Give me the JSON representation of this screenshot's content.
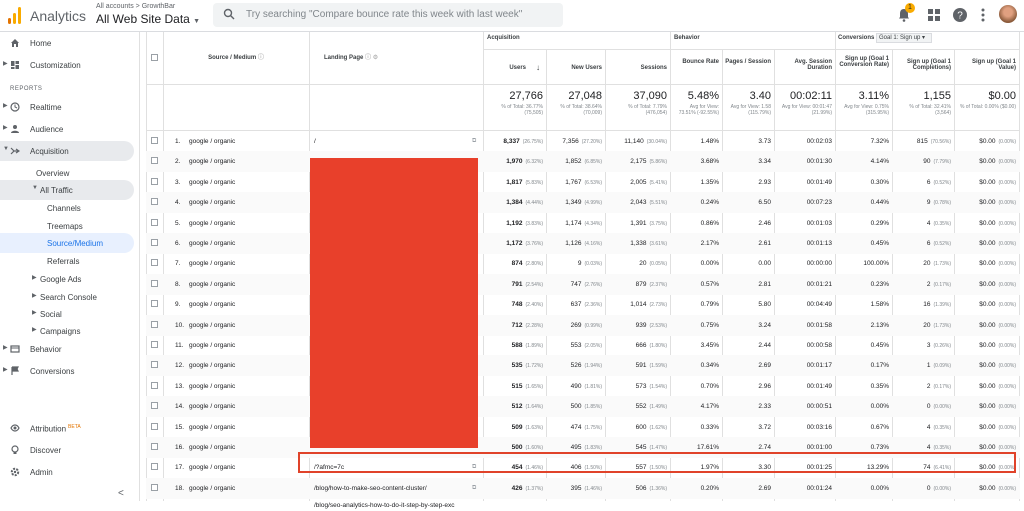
{
  "header": {
    "brand": "Analytics",
    "breadcrumb": "All accounts > GrowthBar",
    "view": "All Web Site Data",
    "search_placeholder": "Try searching \"Compare bounce rate this week with last week\"",
    "notification_count": "1"
  },
  "sidebar": {
    "items": [
      {
        "label": "Home",
        "icon": "home-icon"
      },
      {
        "label": "Customization",
        "icon": "dashboard-icon"
      }
    ],
    "reports_label": "REPORTS",
    "reports": [
      {
        "label": "Realtime",
        "icon": "clock-icon"
      },
      {
        "label": "Audience",
        "icon": "person-icon"
      },
      {
        "label": "Acquisition",
        "icon": "acquisition-icon"
      }
    ],
    "acquisition_children": [
      "Overview",
      "All Traffic",
      "Channels",
      "Treemaps",
      "Source/Medium",
      "Referrals",
      "Google Ads",
      "Search Console",
      "Social",
      "Campaigns"
    ],
    "bottom_reports": [
      {
        "label": "Behavior",
        "icon": "behavior-icon"
      },
      {
        "label": "Conversions",
        "icon": "flag-icon"
      }
    ],
    "footer": [
      {
        "label": "Attribution",
        "badge": "BETA",
        "icon": "attribution-icon"
      },
      {
        "label": "Discover",
        "icon": "bulb-icon"
      },
      {
        "label": "Admin",
        "icon": "gear-icon"
      }
    ],
    "collapse": "<"
  },
  "table": {
    "col_headers": {
      "source": "Source / Medium",
      "landing": "Landing Page",
      "acquisition": "Acquisition",
      "behavior": "Behavior",
      "conversions": "Conversions",
      "goal_select": "Goal 1: Sign up",
      "users": "Users",
      "new_users": "New Users",
      "sessions": "Sessions",
      "bounce_rate": "Bounce Rate",
      "pages_session": "Pages / Session",
      "avg_duration": "Avg. Session Duration",
      "conv_rate": "Sign up (Goal 1 Conversion Rate)",
      "completions": "Sign up (Goal 1 Completions)",
      "value": "Sign up (Goal 1 Value)"
    },
    "totals": {
      "users": "27,766",
      "users_sub": "% of Total: 36.77% (75,505)",
      "new_users": "27,048",
      "new_users_sub": "% of Total: 38.64% (70,009)",
      "sessions": "37,090",
      "sessions_sub": "% of Total: 7.79% (476,054)",
      "bounce": "5.48%",
      "bounce_sub": "Avg for View: 73.51% (-92.55%)",
      "pages": "3.40",
      "pages_sub": "Avg for View: 1.58 (115.79%)",
      "duration": "00:02:11",
      "duration_sub": "Avg for View: 00:01:47 (21.99%)",
      "conv": "3.11%",
      "conv_sub": "Avg for View: 0.75% (315.95%)",
      "completions": "1,155",
      "completions_sub": "% of Total: 32.41% (3,564)",
      "value": "$0.00",
      "value_sub": "% of Total: 0.00% ($0.00)"
    },
    "rows": [
      {
        "n": "1.",
        "src": "google / organic",
        "page": "/",
        "u": "8,337",
        "up": "(26.75%)",
        "nu": "7,356",
        "nup": "(27.20%)",
        "s": "11,140",
        "sp": "(30.04%)",
        "br": "1.48%",
        "ps": "3.73",
        "d": "00:02:03",
        "cr": "7.32%",
        "cm": "815",
        "cmp": "(70.56%)",
        "v": "$0.00",
        "vp": "(0.00%)"
      },
      {
        "n": "2.",
        "src": "google / organic",
        "page": "",
        "u": "1,970",
        "up": "(6.32%)",
        "nu": "1,852",
        "nup": "(6.85%)",
        "s": "2,175",
        "sp": "(5.86%)",
        "br": "3.68%",
        "ps": "3.34",
        "d": "00:01:30",
        "cr": "4.14%",
        "cm": "90",
        "cmp": "(7.79%)",
        "v": "$0.00",
        "vp": "(0.00%)"
      },
      {
        "n": "3.",
        "src": "google / organic",
        "page": "",
        "u": "1,817",
        "up": "(5.83%)",
        "nu": "1,767",
        "nup": "(6.53%)",
        "s": "2,005",
        "sp": "(5.41%)",
        "br": "1.35%",
        "ps": "2.93",
        "d": "00:01:49",
        "cr": "0.30%",
        "cm": "6",
        "cmp": "(0.52%)",
        "v": "$0.00",
        "vp": "(0.00%)"
      },
      {
        "n": "4.",
        "src": "google / organic",
        "page": "",
        "u": "1,384",
        "up": "(4.44%)",
        "nu": "1,349",
        "nup": "(4.99%)",
        "s": "2,043",
        "sp": "(5.51%)",
        "br": "0.24%",
        "ps": "6.50",
        "d": "00:07:23",
        "cr": "0.44%",
        "cm": "9",
        "cmp": "(0.78%)",
        "v": "$0.00",
        "vp": "(0.00%)"
      },
      {
        "n": "5.",
        "src": "google / organic",
        "page": "",
        "u": "1,192",
        "up": "(3.83%)",
        "nu": "1,174",
        "nup": "(4.34%)",
        "s": "1,391",
        "sp": "(3.75%)",
        "br": "0.86%",
        "ps": "2.46",
        "d": "00:01:03",
        "cr": "0.29%",
        "cm": "4",
        "cmp": "(0.35%)",
        "v": "$0.00",
        "vp": "(0.00%)"
      },
      {
        "n": "6.",
        "src": "google / organic",
        "page": "",
        "u": "1,172",
        "up": "(3.76%)",
        "nu": "1,126",
        "nup": "(4.16%)",
        "s": "1,338",
        "sp": "(3.61%)",
        "br": "2.17%",
        "ps": "2.61",
        "d": "00:01:13",
        "cr": "0.45%",
        "cm": "6",
        "cmp": "(0.52%)",
        "v": "$0.00",
        "vp": "(0.00%)"
      },
      {
        "n": "7.",
        "src": "google / organic",
        "page": "",
        "u": "874",
        "up": "(2.80%)",
        "nu": "9",
        "nup": "(0.03%)",
        "s": "20",
        "sp": "(0.05%)",
        "br": "0.00%",
        "ps": "0.00",
        "d": "00:00:00",
        "cr": "100.00%",
        "cm": "20",
        "cmp": "(1.73%)",
        "v": "$0.00",
        "vp": "(0.00%)"
      },
      {
        "n": "8.",
        "src": "google / organic",
        "page": "",
        "u": "791",
        "up": "(2.54%)",
        "nu": "747",
        "nup": "(2.76%)",
        "s": "879",
        "sp": "(2.37%)",
        "br": "0.57%",
        "ps": "2.81",
        "d": "00:01:21",
        "cr": "0.23%",
        "cm": "2",
        "cmp": "(0.17%)",
        "v": "$0.00",
        "vp": "(0.00%)"
      },
      {
        "n": "9.",
        "src": "google / organic",
        "page": "",
        "u": "748",
        "up": "(2.40%)",
        "nu": "637",
        "nup": "(2.36%)",
        "s": "1,014",
        "sp": "(2.73%)",
        "br": "0.79%",
        "ps": "5.80",
        "d": "00:04:49",
        "cr": "1.58%",
        "cm": "16",
        "cmp": "(1.39%)",
        "v": "$0.00",
        "vp": "(0.00%)"
      },
      {
        "n": "10.",
        "src": "google / organic",
        "page": "",
        "u": "712",
        "up": "(2.28%)",
        "nu": "269",
        "nup": "(0.99%)",
        "s": "939",
        "sp": "(2.53%)",
        "br": "0.75%",
        "ps": "3.24",
        "d": "00:01:58",
        "cr": "2.13%",
        "cm": "20",
        "cmp": "(1.73%)",
        "v": "$0.00",
        "vp": "(0.00%)"
      },
      {
        "n": "11.",
        "src": "google / organic",
        "page": "",
        "u": "588",
        "up": "(1.89%)",
        "nu": "553",
        "nup": "(2.05%)",
        "s": "666",
        "sp": "(1.80%)",
        "br": "3.45%",
        "ps": "2.44",
        "d": "00:00:58",
        "cr": "0.45%",
        "cm": "3",
        "cmp": "(0.26%)",
        "v": "$0.00",
        "vp": "(0.00%)"
      },
      {
        "n": "12.",
        "src": "google / organic",
        "page": "",
        "u": "535",
        "up": "(1.72%)",
        "nu": "526",
        "nup": "(1.94%)",
        "s": "591",
        "sp": "(1.59%)",
        "br": "0.34%",
        "ps": "2.69",
        "d": "00:01:17",
        "cr": "0.17%",
        "cm": "1",
        "cmp": "(0.09%)",
        "v": "$0.00",
        "vp": "(0.00%)"
      },
      {
        "n": "13.",
        "src": "google / organic",
        "page": "",
        "u": "515",
        "up": "(1.65%)",
        "nu": "490",
        "nup": "(1.81%)",
        "s": "573",
        "sp": "(1.54%)",
        "br": "0.70%",
        "ps": "2.96",
        "d": "00:01:49",
        "cr": "0.35%",
        "cm": "2",
        "cmp": "(0.17%)",
        "v": "$0.00",
        "vp": "(0.00%)"
      },
      {
        "n": "14.",
        "src": "google / organic",
        "page": "",
        "u": "512",
        "up": "(1.64%)",
        "nu": "500",
        "nup": "(1.85%)",
        "s": "552",
        "sp": "(1.49%)",
        "br": "4.17%",
        "ps": "2.33",
        "d": "00:00:51",
        "cr": "0.00%",
        "cm": "0",
        "cmp": "(0.00%)",
        "v": "$0.00",
        "vp": "(0.00%)"
      },
      {
        "n": "15.",
        "src": "google / organic",
        "page": "",
        "u": "509",
        "up": "(1.63%)",
        "nu": "474",
        "nup": "(1.75%)",
        "s": "600",
        "sp": "(1.62%)",
        "br": "0.33%",
        "ps": "3.72",
        "d": "00:03:16",
        "cr": "0.67%",
        "cm": "4",
        "cmp": "(0.35%)",
        "v": "$0.00",
        "vp": "(0.00%)"
      },
      {
        "n": "16.",
        "src": "google / organic",
        "page": "",
        "u": "500",
        "up": "(1.60%)",
        "nu": "495",
        "nup": "(1.83%)",
        "s": "545",
        "sp": "(1.47%)",
        "br": "17.61%",
        "ps": "2.74",
        "d": "00:01:00",
        "cr": "0.73%",
        "cm": "4",
        "cmp": "(0.35%)",
        "v": "$0.00",
        "vp": "(0.00%)"
      },
      {
        "n": "17.",
        "src": "google / organic",
        "page": "/?afmc=7c",
        "u": "454",
        "up": "(1.46%)",
        "nu": "406",
        "nup": "(1.50%)",
        "s": "557",
        "sp": "(1.50%)",
        "br": "1.97%",
        "ps": "3.30",
        "d": "00:01:25",
        "cr": "13.29%",
        "cm": "74",
        "cmp": "(6.41%)",
        "v": "$0.00",
        "vp": "(0.00%)"
      },
      {
        "n": "18.",
        "src": "google / organic",
        "page": "/blog/how-to-make-seo-content-cluster/",
        "u": "426",
        "up": "(1.37%)",
        "nu": "395",
        "nup": "(1.46%)",
        "s": "506",
        "sp": "(1.36%)",
        "br": "0.20%",
        "ps": "2.69",
        "d": "00:01:24",
        "cr": "0.00%",
        "cm": "0",
        "cmp": "(0.00%)",
        "v": "$0.00",
        "vp": "(0.00%)"
      }
    ],
    "next_row_partial": "/blog/seo-analytics-how-to-do-it-step-by-step-exc"
  },
  "colors": {
    "highlight": "#e0432a",
    "redaction": "#e8402b",
    "accent": "#1a73e8",
    "logo_orange": "#f9ab00",
    "logo_dark": "#e37400"
  }
}
